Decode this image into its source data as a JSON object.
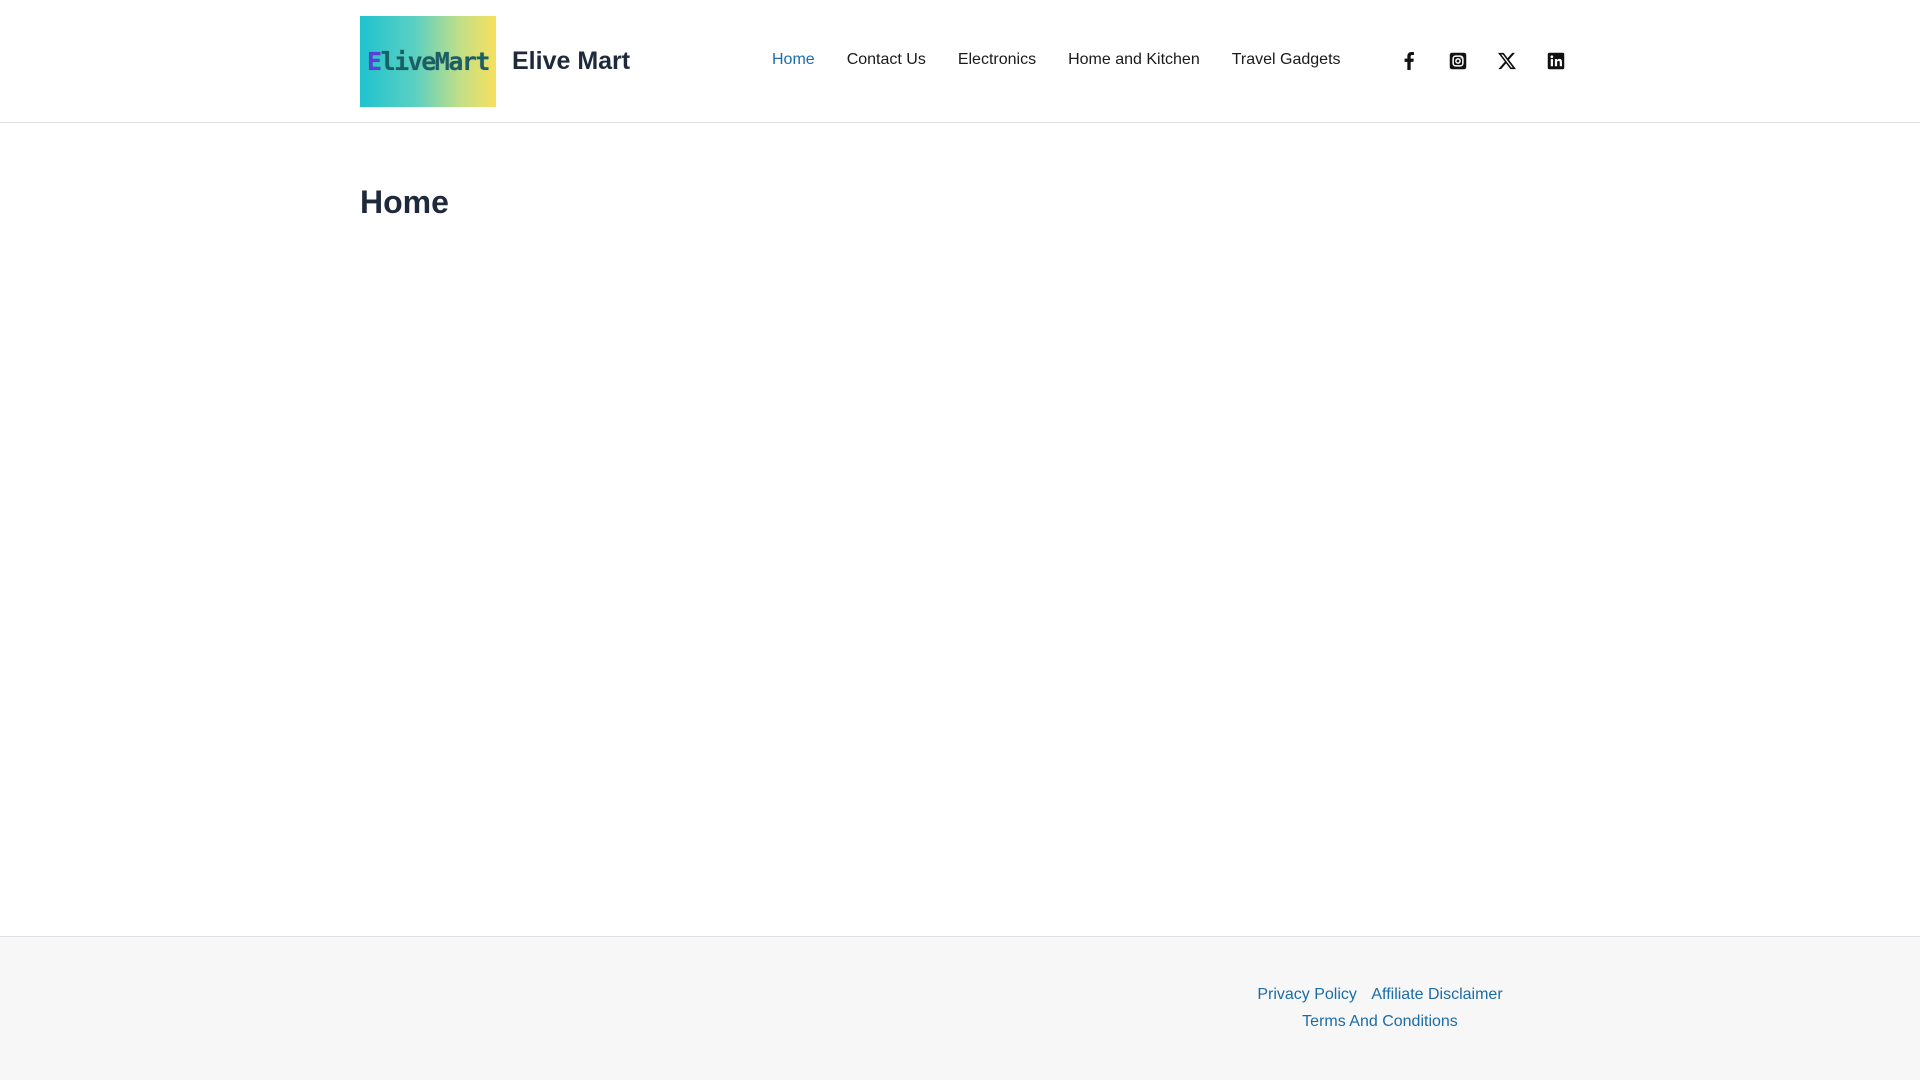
{
  "header": {
    "logo": {
      "text_first": "E",
      "text_rest": "liveMart",
      "gradient": [
        "#1fc3cf",
        "#f6e05e"
      ]
    },
    "site_title": "Elive Mart",
    "nav": [
      {
        "label": "Home",
        "active": true
      },
      {
        "label": "Contact Us",
        "active": false
      },
      {
        "label": "Electronics",
        "active": false
      },
      {
        "label": "Home and Kitchen",
        "active": false
      },
      {
        "label": "Travel Gadgets",
        "active": false
      }
    ],
    "social_icons": [
      "facebook-icon",
      "instagram-icon",
      "x-twitter-icon",
      "linkedin-icon"
    ]
  },
  "main": {
    "page_title": "Home"
  },
  "footer": {
    "links": [
      {
        "label": "Privacy Policy"
      },
      {
        "label": "Affiliate Disclaimer"
      },
      {
        "label": "Terms And Conditions"
      }
    ]
  },
  "colors": {
    "accent": "#1b6ca8",
    "heading": "#1e293b",
    "footer_bg": "#f7f7f7"
  }
}
